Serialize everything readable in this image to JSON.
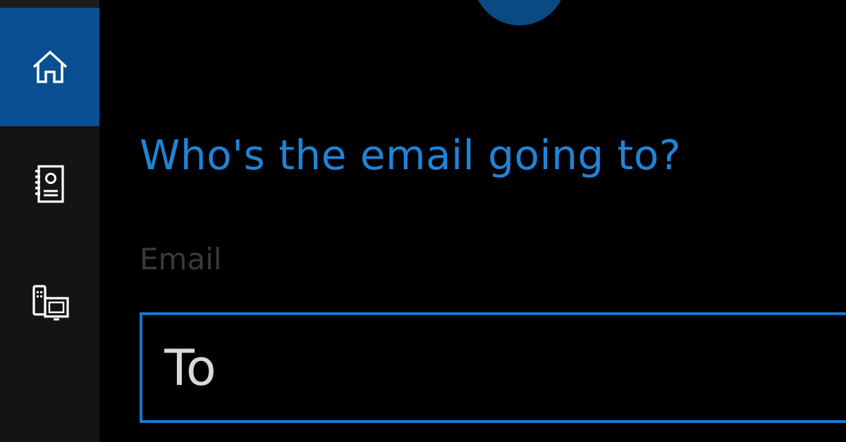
{
  "nav": {
    "items": [
      {
        "icon": "home-icon",
        "active": true
      },
      {
        "icon": "notebook-icon",
        "active": false
      },
      {
        "icon": "devices-icon",
        "active": false
      }
    ]
  },
  "colors": {
    "accent": "#1f84d8",
    "nav_active": "#0a4f92",
    "border": "#1877d0",
    "avatar": "#0a4a83"
  },
  "question": "Who's the email going to?",
  "email": {
    "label": "Email",
    "to_placeholder": "To",
    "to_value": ""
  }
}
